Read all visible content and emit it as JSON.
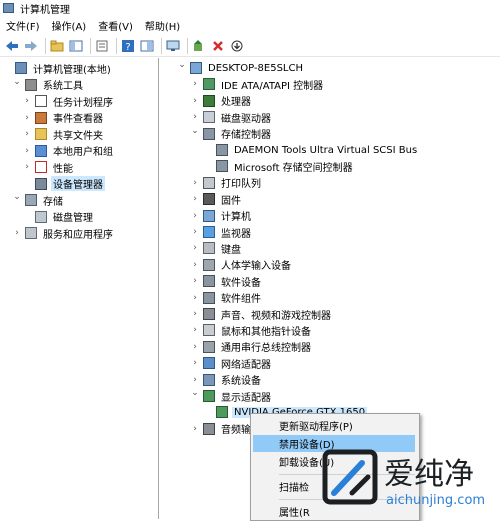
{
  "window": {
    "title": "计算机管理"
  },
  "menu": [
    "文件(F)",
    "操作(A)",
    "查看(V)",
    "帮助(H)"
  ],
  "toolbar_icons": [
    "back-arrow-icon",
    "forward-arrow-icon",
    "up-folder-icon",
    "show-tree-icon",
    "properties-icon",
    "help-icon",
    "console-tree-icon",
    "monitor-icon",
    "update-driver-icon",
    "uninstall-icon",
    "download-icon"
  ],
  "left_tree": [
    {
      "label": "计算机管理(本地)",
      "indent": 0,
      "twisty": "",
      "icon": "computer-management-icon"
    },
    {
      "label": "系统工具",
      "indent": 1,
      "twisty": "expanded",
      "icon": "system-tools-icon"
    },
    {
      "label": "任务计划程序",
      "indent": 2,
      "twisty": "collapsed",
      "icon": "task-scheduler-icon"
    },
    {
      "label": "事件查看器",
      "indent": 2,
      "twisty": "collapsed",
      "icon": "event-viewer-icon"
    },
    {
      "label": "共享文件夹",
      "indent": 2,
      "twisty": "collapsed",
      "icon": "shared-folder-icon"
    },
    {
      "label": "本地用户和组",
      "indent": 2,
      "twisty": "collapsed",
      "icon": "users-icon"
    },
    {
      "label": "性能",
      "indent": 2,
      "twisty": "collapsed",
      "icon": "performance-icon"
    },
    {
      "label": "设备管理器",
      "indent": 2,
      "twisty": "",
      "icon": "device-manager-icon",
      "selected": true
    },
    {
      "label": "存储",
      "indent": 1,
      "twisty": "expanded",
      "icon": "storage-icon"
    },
    {
      "label": "磁盘管理",
      "indent": 2,
      "twisty": "",
      "icon": "disk-management-icon"
    },
    {
      "label": "服务和应用程序",
      "indent": 1,
      "twisty": "collapsed",
      "icon": "services-icon"
    }
  ],
  "right_tree": [
    {
      "label": "DESKTOP-8E5SLCH",
      "indent": 0,
      "twisty": "expanded",
      "icon": "computer-icon"
    },
    {
      "label": "IDE ATA/ATAPI 控制器",
      "indent": 1,
      "twisty": "collapsed",
      "icon": "ide-controller-icon"
    },
    {
      "label": "处理器",
      "indent": 1,
      "twisty": "collapsed",
      "icon": "processor-icon"
    },
    {
      "label": "磁盘驱动器",
      "indent": 1,
      "twisty": "collapsed",
      "icon": "disk-drive-icon"
    },
    {
      "label": "存储控制器",
      "indent": 1,
      "twisty": "expanded",
      "icon": "storage-controller-icon"
    },
    {
      "label": "DAEMON Tools Ultra Virtual SCSI Bus",
      "indent": 2,
      "twisty": "",
      "icon": "storage-controller-icon"
    },
    {
      "label": "Microsoft 存储空间控制器",
      "indent": 2,
      "twisty": "",
      "icon": "storage-controller-icon"
    },
    {
      "label": "打印队列",
      "indent": 1,
      "twisty": "collapsed",
      "icon": "printer-icon"
    },
    {
      "label": "固件",
      "indent": 1,
      "twisty": "collapsed",
      "icon": "firmware-icon"
    },
    {
      "label": "计算机",
      "indent": 1,
      "twisty": "collapsed",
      "icon": "computer-icon"
    },
    {
      "label": "监视器",
      "indent": 1,
      "twisty": "collapsed",
      "icon": "monitor-icon"
    },
    {
      "label": "键盘",
      "indent": 1,
      "twisty": "collapsed",
      "icon": "keyboard-icon"
    },
    {
      "label": "人体学输入设备",
      "indent": 1,
      "twisty": "collapsed",
      "icon": "hid-icon"
    },
    {
      "label": "软件设备",
      "indent": 1,
      "twisty": "collapsed",
      "icon": "software-device-icon"
    },
    {
      "label": "软件组件",
      "indent": 1,
      "twisty": "collapsed",
      "icon": "software-component-icon"
    },
    {
      "label": "声音、视频和游戏控制器",
      "indent": 1,
      "twisty": "collapsed",
      "icon": "sound-icon"
    },
    {
      "label": "鼠标和其他指针设备",
      "indent": 1,
      "twisty": "collapsed",
      "icon": "mouse-icon"
    },
    {
      "label": "通用串行总线控制器",
      "indent": 1,
      "twisty": "collapsed",
      "icon": "usb-icon"
    },
    {
      "label": "网络适配器",
      "indent": 1,
      "twisty": "collapsed",
      "icon": "network-adapter-icon"
    },
    {
      "label": "系统设备",
      "indent": 1,
      "twisty": "collapsed",
      "icon": "system-device-icon"
    },
    {
      "label": "显示适配器",
      "indent": 1,
      "twisty": "expanded",
      "icon": "display-adapter-icon"
    },
    {
      "label": "NVIDIA GeForce GTX 1650",
      "indent": 2,
      "twisty": "",
      "icon": "display-adapter-icon",
      "selected": true
    },
    {
      "label": "音频输入",
      "indent": 1,
      "twisty": "collapsed",
      "icon": "audio-input-icon"
    }
  ],
  "context_menu": [
    {
      "label": "更新驱动程序(P)"
    },
    {
      "label": "禁用设备(D)",
      "highlighted": true
    },
    {
      "label": "卸载设备(U)"
    },
    {
      "separator": true
    },
    {
      "label": "扫描检"
    },
    {
      "separator": true
    },
    {
      "label": "属性(R"
    }
  ],
  "watermark": {
    "brand": "爱纯净",
    "domain": "aichunjing.com"
  },
  "colors": {
    "selection": "#cce8ff",
    "menu_highlight": "#91c9f7",
    "watermark_blue": "#2a7fd6"
  }
}
